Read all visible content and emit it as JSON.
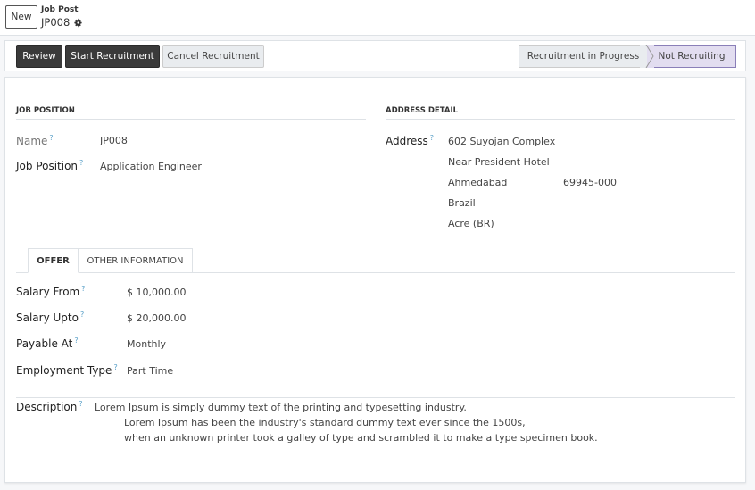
{
  "header": {
    "new_label": "New",
    "breadcrumb_parent": "Job Post",
    "breadcrumb_current": "JP008"
  },
  "actions": {
    "review": "Review",
    "start_recruitment": "Start Recruitment",
    "cancel_recruitment": "Cancel Recruitment"
  },
  "stages": {
    "in_progress": "Recruitment in Progress",
    "not_recruiting": "Not Recruiting",
    "current": "Not Recruiting"
  },
  "job_position": {
    "section_title": "JOB POSITION",
    "name_label": "Name",
    "name_value": "JP008",
    "position_label": "Job Position",
    "position_value": "Application Engineer"
  },
  "address": {
    "section_title": "ADDRESS DETAIL",
    "label": "Address",
    "street": "602 Suyojan Complex",
    "street2": "Near President Hotel",
    "city": "Ahmedabad",
    "zip": "69945-000",
    "country": "Brazil",
    "state": "Acre (BR)"
  },
  "tabs": {
    "offer": "OFFER",
    "other": "OTHER INFORMATION"
  },
  "offer": {
    "salary_from_label": "Salary From",
    "salary_from_value": "$ 10,000.00",
    "salary_upto_label": "Salary Upto",
    "salary_upto_value": "$ 20,000.00",
    "payable_label": "Payable At",
    "payable_value": "Monthly",
    "employment_label": "Employment Type",
    "employment_value": "Part Time"
  },
  "description": {
    "label": "Description",
    "line1": "Lorem Ipsum is simply dummy text of the printing and typesetting industry.",
    "line2": "Lorem Ipsum has been the industry's standard dummy text ever since the 1500s,",
    "line3": "when an unknown printer took a galley of type and scrambled it to make a type specimen book."
  },
  "colors": {
    "primary_button": "#3a3a3a",
    "active_stage": "#e2ddf0",
    "tooltip_mark": "#5aa0c8"
  }
}
